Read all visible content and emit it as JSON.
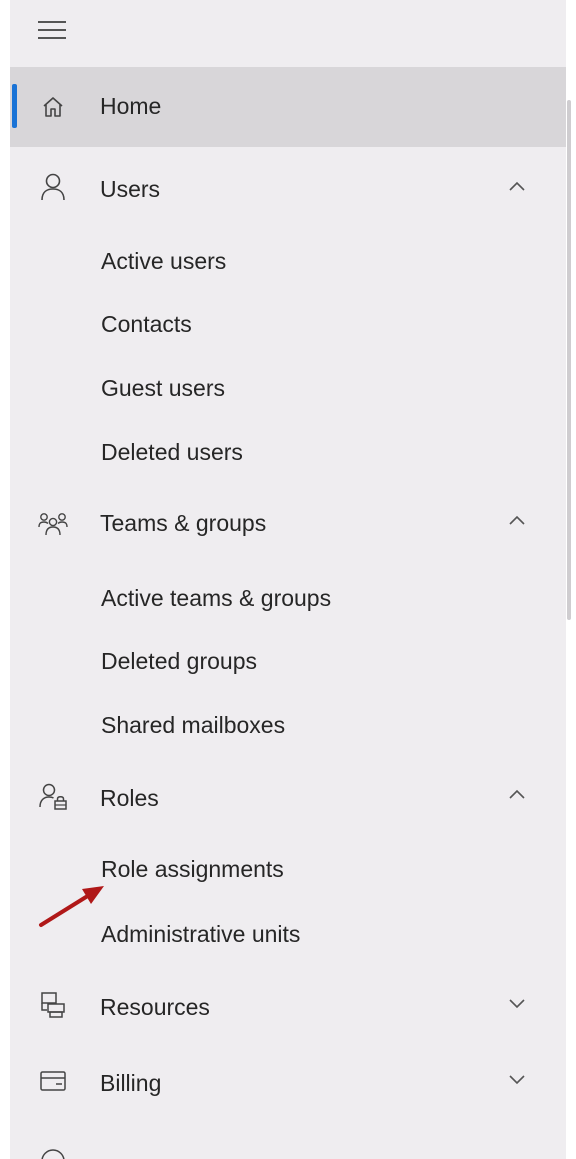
{
  "nav": {
    "items": [
      {
        "label": "Home",
        "icon": "home-icon",
        "selected": true
      },
      {
        "label": "Users",
        "icon": "user-icon",
        "expanded": true,
        "children": [
          "Active users",
          "Contacts",
          "Guest users",
          "Deleted users"
        ]
      },
      {
        "label": "Teams & groups",
        "icon": "group-icon",
        "expanded": true,
        "children": [
          "Active teams & groups",
          "Deleted groups",
          "Shared mailboxes"
        ]
      },
      {
        "label": "Roles",
        "icon": "role-icon",
        "expanded": true,
        "children": [
          "Role assignments",
          "Administrative units"
        ]
      },
      {
        "label": "Resources",
        "icon": "resources-icon",
        "expanded": false
      },
      {
        "label": "Billing",
        "icon": "billing-icon",
        "expanded": false
      }
    ]
  },
  "colors": {
    "nav_background": "#efedf0",
    "selected_background": "#d8d6d9",
    "accent": "#1a73d6",
    "annotation_arrow": "#b01818"
  }
}
